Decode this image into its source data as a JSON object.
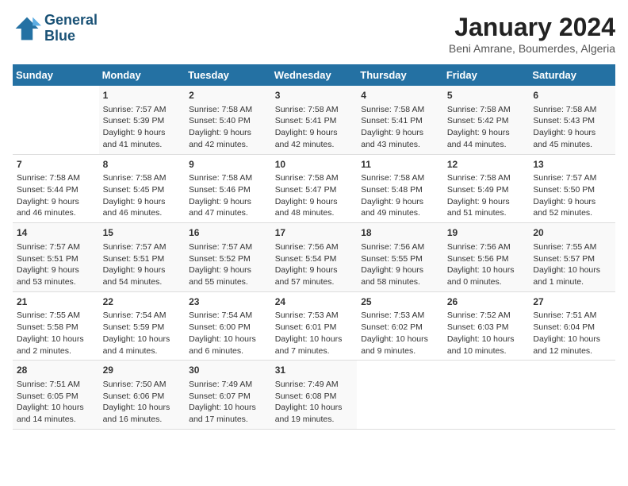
{
  "logo": {
    "line1": "General",
    "line2": "Blue"
  },
  "title": "January 2024",
  "subtitle": "Beni Amrane, Boumerdes, Algeria",
  "days_header": [
    "Sunday",
    "Monday",
    "Tuesday",
    "Wednesday",
    "Thursday",
    "Friday",
    "Saturday"
  ],
  "weeks": [
    [
      {
        "day": "",
        "info": ""
      },
      {
        "day": "1",
        "info": "Sunrise: 7:57 AM\nSunset: 5:39 PM\nDaylight: 9 hours\nand 41 minutes."
      },
      {
        "day": "2",
        "info": "Sunrise: 7:58 AM\nSunset: 5:40 PM\nDaylight: 9 hours\nand 42 minutes."
      },
      {
        "day": "3",
        "info": "Sunrise: 7:58 AM\nSunset: 5:41 PM\nDaylight: 9 hours\nand 42 minutes."
      },
      {
        "day": "4",
        "info": "Sunrise: 7:58 AM\nSunset: 5:41 PM\nDaylight: 9 hours\nand 43 minutes."
      },
      {
        "day": "5",
        "info": "Sunrise: 7:58 AM\nSunset: 5:42 PM\nDaylight: 9 hours\nand 44 minutes."
      },
      {
        "day": "6",
        "info": "Sunrise: 7:58 AM\nSunset: 5:43 PM\nDaylight: 9 hours\nand 45 minutes."
      }
    ],
    [
      {
        "day": "7",
        "info": "Sunrise: 7:58 AM\nSunset: 5:44 PM\nDaylight: 9 hours\nand 46 minutes."
      },
      {
        "day": "8",
        "info": "Sunrise: 7:58 AM\nSunset: 5:45 PM\nDaylight: 9 hours\nand 46 minutes."
      },
      {
        "day": "9",
        "info": "Sunrise: 7:58 AM\nSunset: 5:46 PM\nDaylight: 9 hours\nand 47 minutes."
      },
      {
        "day": "10",
        "info": "Sunrise: 7:58 AM\nSunset: 5:47 PM\nDaylight: 9 hours\nand 48 minutes."
      },
      {
        "day": "11",
        "info": "Sunrise: 7:58 AM\nSunset: 5:48 PM\nDaylight: 9 hours\nand 49 minutes."
      },
      {
        "day": "12",
        "info": "Sunrise: 7:58 AM\nSunset: 5:49 PM\nDaylight: 9 hours\nand 51 minutes."
      },
      {
        "day": "13",
        "info": "Sunrise: 7:57 AM\nSunset: 5:50 PM\nDaylight: 9 hours\nand 52 minutes."
      }
    ],
    [
      {
        "day": "14",
        "info": "Sunrise: 7:57 AM\nSunset: 5:51 PM\nDaylight: 9 hours\nand 53 minutes."
      },
      {
        "day": "15",
        "info": "Sunrise: 7:57 AM\nSunset: 5:51 PM\nDaylight: 9 hours\nand 54 minutes."
      },
      {
        "day": "16",
        "info": "Sunrise: 7:57 AM\nSunset: 5:52 PM\nDaylight: 9 hours\nand 55 minutes."
      },
      {
        "day": "17",
        "info": "Sunrise: 7:56 AM\nSunset: 5:54 PM\nDaylight: 9 hours\nand 57 minutes."
      },
      {
        "day": "18",
        "info": "Sunrise: 7:56 AM\nSunset: 5:55 PM\nDaylight: 9 hours\nand 58 minutes."
      },
      {
        "day": "19",
        "info": "Sunrise: 7:56 AM\nSunset: 5:56 PM\nDaylight: 10 hours\nand 0 minutes."
      },
      {
        "day": "20",
        "info": "Sunrise: 7:55 AM\nSunset: 5:57 PM\nDaylight: 10 hours\nand 1 minute."
      }
    ],
    [
      {
        "day": "21",
        "info": "Sunrise: 7:55 AM\nSunset: 5:58 PM\nDaylight: 10 hours\nand 2 minutes."
      },
      {
        "day": "22",
        "info": "Sunrise: 7:54 AM\nSunset: 5:59 PM\nDaylight: 10 hours\nand 4 minutes."
      },
      {
        "day": "23",
        "info": "Sunrise: 7:54 AM\nSunset: 6:00 PM\nDaylight: 10 hours\nand 6 minutes."
      },
      {
        "day": "24",
        "info": "Sunrise: 7:53 AM\nSunset: 6:01 PM\nDaylight: 10 hours\nand 7 minutes."
      },
      {
        "day": "25",
        "info": "Sunrise: 7:53 AM\nSunset: 6:02 PM\nDaylight: 10 hours\nand 9 minutes."
      },
      {
        "day": "26",
        "info": "Sunrise: 7:52 AM\nSunset: 6:03 PM\nDaylight: 10 hours\nand 10 minutes."
      },
      {
        "day": "27",
        "info": "Sunrise: 7:51 AM\nSunset: 6:04 PM\nDaylight: 10 hours\nand 12 minutes."
      }
    ],
    [
      {
        "day": "28",
        "info": "Sunrise: 7:51 AM\nSunset: 6:05 PM\nDaylight: 10 hours\nand 14 minutes."
      },
      {
        "day": "29",
        "info": "Sunrise: 7:50 AM\nSunset: 6:06 PM\nDaylight: 10 hours\nand 16 minutes."
      },
      {
        "day": "30",
        "info": "Sunrise: 7:49 AM\nSunset: 6:07 PM\nDaylight: 10 hours\nand 17 minutes."
      },
      {
        "day": "31",
        "info": "Sunrise: 7:49 AM\nSunset: 6:08 PM\nDaylight: 10 hours\nand 19 minutes."
      },
      {
        "day": "",
        "info": ""
      },
      {
        "day": "",
        "info": ""
      },
      {
        "day": "",
        "info": ""
      }
    ]
  ]
}
